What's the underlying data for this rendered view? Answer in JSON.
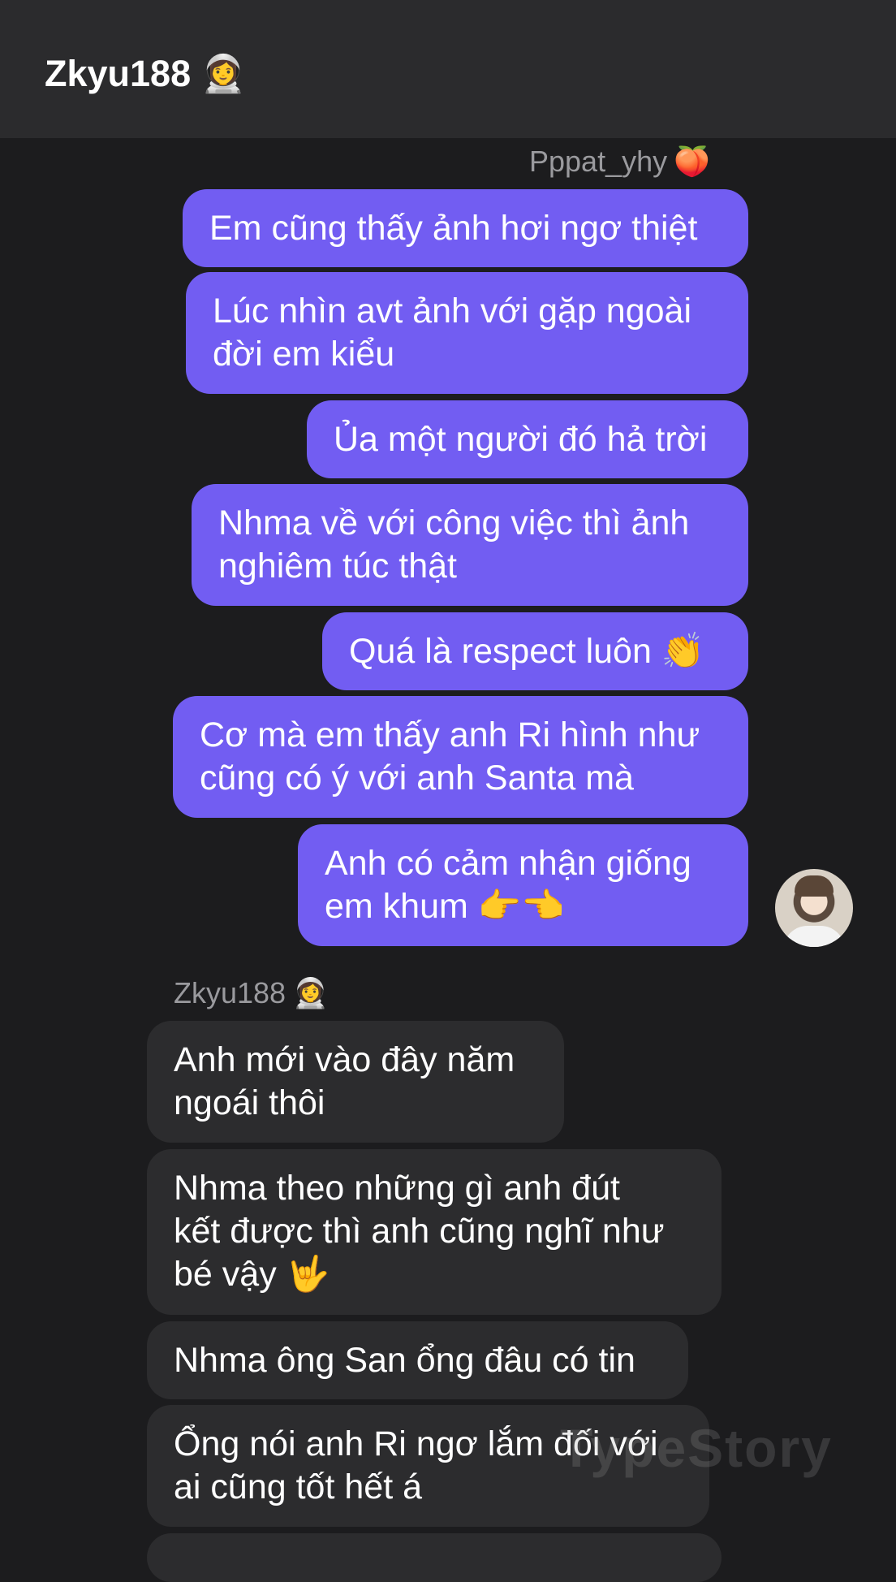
{
  "header": {
    "title": "Zkyu188",
    "title_emoji": "👩‍🚀"
  },
  "messages": {
    "sender_name": "Pppat_yhy",
    "sender_emoji": "🍑",
    "sent": [
      "Em cũng thấy ảnh hơi ngơ thiệt",
      "Lúc nhìn avt ảnh với gặp ngoài\nđời em kiểu",
      "Ủa một người đó hả trời",
      "Nhma về với công việc thì ảnh\nnghiêm túc thật",
      "Quá là respect luôn 👏",
      "Cơ mà em thấy anh Ri hình như\ncũng có ý với anh Santa mà",
      "Anh có cảm nhận giống\nem khum 👉👈"
    ],
    "receiver_name": "Zkyu188",
    "receiver_emoji": "👩‍🚀",
    "received": [
      "Anh mới vào đây năm\nngoái thôi",
      "Nhma theo những gì anh đút\nkết được thì anh cũng nghĩ như\nbé vậy 🤟",
      "Nhma ông San ổng đâu có tin",
      "Ổng nói anh Ri ngơ lắm đối với\nai cũng tốt hết á"
    ]
  },
  "watermark": "TypeStory"
}
